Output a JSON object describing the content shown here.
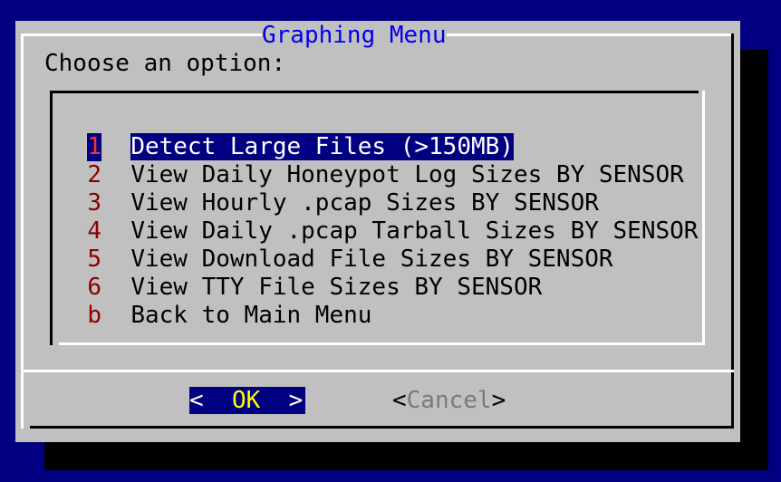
{
  "dialog": {
    "title": "Graphing Menu",
    "prompt": "Choose an option:"
  },
  "menu": {
    "items": [
      {
        "key": "1",
        "label": "Detect Large Files (>150MB)",
        "selected": true
      },
      {
        "key": "2",
        "label": "View Daily Honeypot Log Sizes BY SENSOR"
      },
      {
        "key": "3",
        "label": "View Hourly .pcap Sizes BY SENSOR"
      },
      {
        "key": "4",
        "label": "View Daily .pcap Tarball Sizes BY SENSOR"
      },
      {
        "key": "5",
        "label": "View Download File Sizes BY SENSOR"
      },
      {
        "key": "6",
        "label": "View TTY File Sizes BY SENSOR"
      },
      {
        "key": "b",
        "label": "Back to Main Menu"
      }
    ]
  },
  "buttons": {
    "ok": {
      "open": "<",
      "label": "OK",
      "close": ">"
    },
    "cancel": {
      "open": "<",
      "label": "Cancel",
      "close": ">"
    }
  },
  "colors": {
    "desktop": "#000080",
    "dialog": "#c0c0c0",
    "title": "#0000ee",
    "key": "#8b0000",
    "selection": "#000080",
    "ok_label": "#ffff00",
    "cancel_label": "#7a7a7a"
  }
}
